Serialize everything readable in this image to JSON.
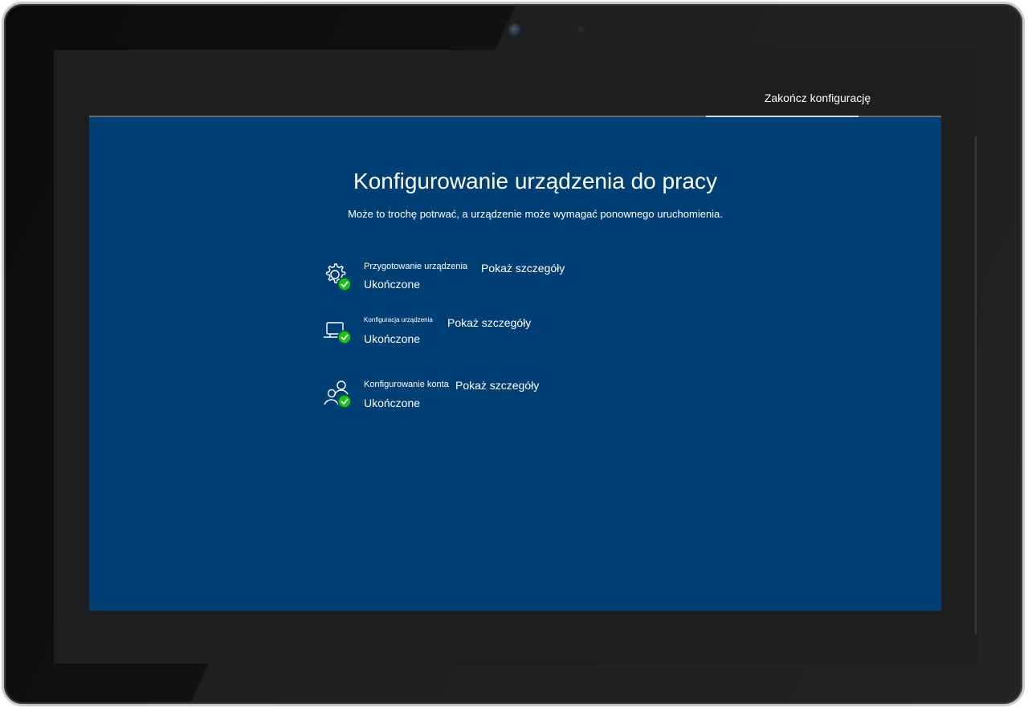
{
  "header": {
    "finish_tab": "Zakończ konfigurację"
  },
  "main": {
    "title": "Konfigurowanie urządzenia do pracy",
    "subtitle": "Może to trochę potrwać, a urządzenie może wymagać ponownego uruchomienia."
  },
  "steps": [
    {
      "title": "Przygotowanie urządzenia",
      "link": "Pokaż szczegóły",
      "status": "Ukończone",
      "icon": "gear-check-icon"
    },
    {
      "title": "Konfiguracja urządzenia",
      "link": "Pokaż szczegóły",
      "status": "Ukończone",
      "icon": "device-check-icon"
    },
    {
      "title": "Konfigurowanie konta",
      "link": "Pokaż szczegóły",
      "status": "Ukończone",
      "icon": "users-check-icon"
    }
  ],
  "colors": {
    "panel": "#003f74",
    "check": "#16c60c",
    "frame": "#1e1e1e"
  }
}
